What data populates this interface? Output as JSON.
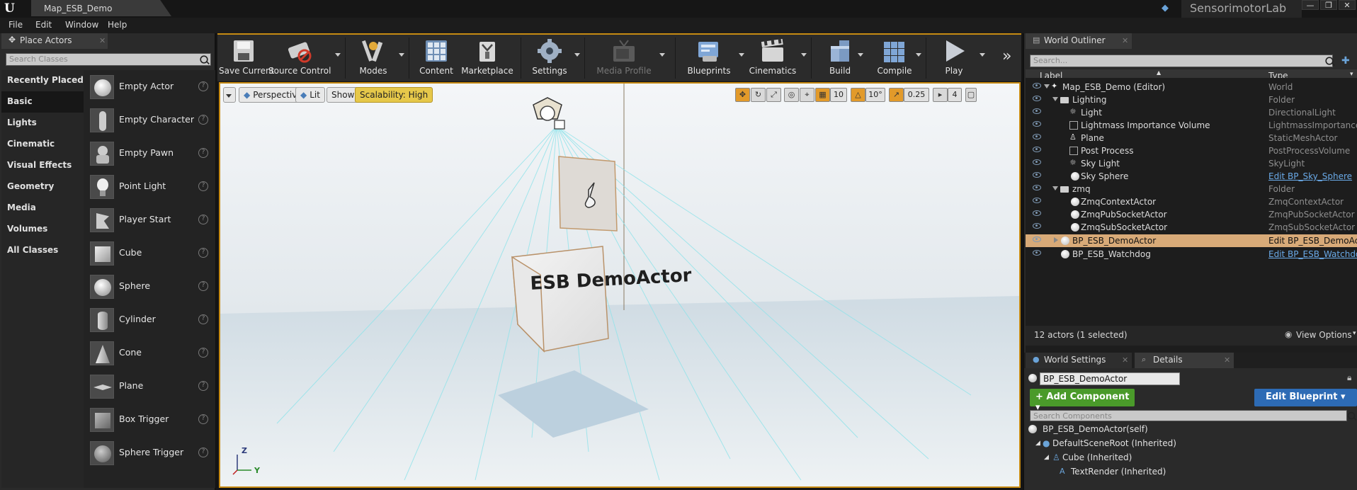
{
  "titlebar": {
    "doc_tab": "Map_ESB_Demo",
    "project": "SensorimotorLab",
    "buttons": [
      "—",
      "❐",
      "✕"
    ]
  },
  "menu": [
    "File",
    "Edit",
    "Window",
    "Help"
  ],
  "place_actors": {
    "tab_label": "Place Actors",
    "search_placeholder": "Search Classes",
    "categories": [
      "Recently Placed",
      "Basic",
      "Lights",
      "Cinematic",
      "Visual Effects",
      "Geometry",
      "Media",
      "Volumes",
      "All Classes"
    ],
    "active_category": "Basic",
    "actors": [
      "Empty Actor",
      "Empty Character",
      "Empty Pawn",
      "Point Light",
      "Player Start",
      "Cube",
      "Sphere",
      "Cylinder",
      "Cone",
      "Plane",
      "Box Trigger",
      "Sphere Trigger"
    ],
    "help_glyph": "?"
  },
  "toolbar": {
    "buttons": [
      {
        "label": "Save Current",
        "icon": "save-icon"
      },
      {
        "label": "Source Control",
        "icon": "source-control-icon"
      },
      {
        "label": "Modes",
        "icon": "modes-icon"
      },
      {
        "label": "Content",
        "icon": "content-icon"
      },
      {
        "label": "Marketplace",
        "icon": "marketplace-icon"
      },
      {
        "label": "Settings",
        "icon": "settings-icon"
      },
      {
        "label": "Media Profile",
        "icon": "media-profile-icon"
      },
      {
        "label": "Blueprints",
        "icon": "blueprints-icon"
      },
      {
        "label": "Cinematics",
        "icon": "cinematics-icon"
      },
      {
        "label": "Build",
        "icon": "build-icon"
      },
      {
        "label": "Compile",
        "icon": "compile-icon"
      },
      {
        "label": "Play",
        "icon": "play-icon"
      }
    ],
    "overflow": "»"
  },
  "viewport": {
    "perspective": "Perspective",
    "lit": "Lit",
    "show": "Show",
    "scalability": "Scalability: High",
    "grid_snap": "10",
    "rotation_snap": "10°",
    "scale_snap": "0.25",
    "camera_speed": "4",
    "text_render": "ESB DemoActor",
    "axis_z": "Z",
    "axis_y": "Y"
  },
  "outliner": {
    "tab_label": "World Outliner",
    "search_placeholder": "Search...",
    "col_label": "Label",
    "col_type": "Type",
    "rows": [
      {
        "label": "Map_ESB_Demo (Editor)",
        "type": "World"
      },
      {
        "label": "Lighting",
        "type": "Folder"
      },
      {
        "label": "Light",
        "type": "DirectionalLight"
      },
      {
        "label": "Lightmass Importance Volume",
        "type": "LightmassImportanceV"
      },
      {
        "label": "Plane",
        "type": "StaticMeshActor"
      },
      {
        "label": "Post Process",
        "type": "PostProcessVolume"
      },
      {
        "label": "Sky Light",
        "type": "SkyLight"
      },
      {
        "label": "Sky Sphere",
        "type": "Edit BP_Sky_Sphere"
      },
      {
        "label": "zmq",
        "type": "Folder"
      },
      {
        "label": "ZmqContextActor",
        "type": "ZmqContextActor"
      },
      {
        "label": "ZmqPubSocketActor",
        "type": "ZmqPubSocketActor"
      },
      {
        "label": "ZmqSubSocketActor",
        "type": "ZmqSubSocketActor"
      },
      {
        "label": "BP_ESB_DemoActor",
        "type": "Edit BP_ESB_DemoActo"
      },
      {
        "label": "BP_ESB_Watchdog",
        "type": "Edit BP_ESB_Watchdo"
      }
    ],
    "status": "12 actors (1 selected)",
    "view_options": "View Options"
  },
  "details": {
    "world_settings_tab": "World Settings",
    "details_tab": "Details",
    "name_value": "BP_ESB_DemoActor",
    "add_component": "+ Add Component ▾",
    "edit_blueprint": "Edit Blueprint ▾",
    "search_placeholder": "Search Components",
    "self_row": "BP_ESB_DemoActor(self)",
    "components": [
      "DefaultSceneRoot (Inherited)",
      "Cube (Inherited)",
      "TextRender (Inherited)"
    ]
  },
  "colors": {
    "accent": "#c68a12",
    "selected_row": "#d8aa78",
    "add_component": "#4a9a2a",
    "edit_blueprint": "#2d6bb5",
    "link": "#6aaae8"
  }
}
